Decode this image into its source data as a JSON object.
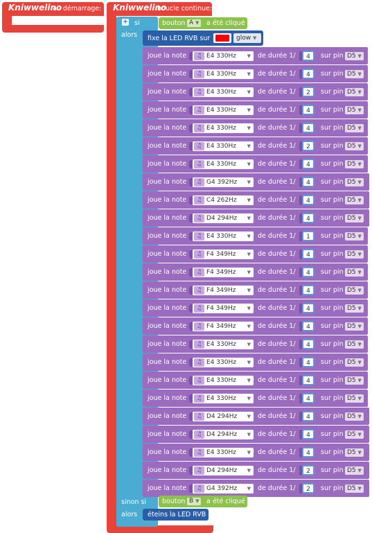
{
  "startup_block": {
    "logo": "Kniwwelino",
    "label": "au démarrage:"
  },
  "loop_block": {
    "logo": "Kniwwelino",
    "label": "boucle continue:"
  },
  "if_block": {
    "if_label": "si",
    "then_label": "alors",
    "elseif_label": "sinon si",
    "else_then_label": "alors",
    "condition1": {
      "prefix": "bouton",
      "button": "A",
      "suffix": "a été cliqué"
    },
    "condition2": {
      "prefix": "bouton",
      "button": "B",
      "suffix": "a été cliqué"
    },
    "led_block": {
      "label": "fixe la LED RVB sur",
      "color": "#ff0000",
      "mode": "glow"
    },
    "led_off_label": "éteins la LED RVB"
  },
  "note_labels": {
    "play": "joue la note",
    "duration": "de durée 1/",
    "pin": "sur pin"
  },
  "notes": [
    {
      "note": "E4 330Hz",
      "duration": "4",
      "pin": "D5"
    },
    {
      "note": "E4 330Hz",
      "duration": "4",
      "pin": "D5"
    },
    {
      "note": "E4 330Hz",
      "duration": "2",
      "pin": "D5"
    },
    {
      "note": "E4 330Hz",
      "duration": "4",
      "pin": "D5"
    },
    {
      "note": "E4 330Hz",
      "duration": "4",
      "pin": "D5"
    },
    {
      "note": "E4 330Hz",
      "duration": "2",
      "pin": "D5"
    },
    {
      "note": "E4 330Hz",
      "duration": "4",
      "pin": "D5"
    },
    {
      "note": "G4 392Hz",
      "duration": "4",
      "pin": "D5"
    },
    {
      "note": "C4 262Hz",
      "duration": "4",
      "pin": "D5"
    },
    {
      "note": "D4 294Hz",
      "duration": "4",
      "pin": "D5"
    },
    {
      "note": "E4 330Hz",
      "duration": "1",
      "pin": "D5"
    },
    {
      "note": "F4 349Hz",
      "duration": "4",
      "pin": "D5"
    },
    {
      "note": "F4 349Hz",
      "duration": "4",
      "pin": "D5"
    },
    {
      "note": "F4 349Hz",
      "duration": "4",
      "pin": "D5"
    },
    {
      "note": "F4 349Hz",
      "duration": "4",
      "pin": "D5"
    },
    {
      "note": "F4 349Hz",
      "duration": "4",
      "pin": "D5"
    },
    {
      "note": "E4 330Hz",
      "duration": "4",
      "pin": "D5"
    },
    {
      "note": "E4 330Hz",
      "duration": "4",
      "pin": "D5"
    },
    {
      "note": "E4 330Hz",
      "duration": "4",
      "pin": "D5"
    },
    {
      "note": "E4 330Hz",
      "duration": "4",
      "pin": "D5"
    },
    {
      "note": "D4 294Hz",
      "duration": "4",
      "pin": "D5"
    },
    {
      "note": "D4 294Hz",
      "duration": "4",
      "pin": "D5"
    },
    {
      "note": "E4 330Hz",
      "duration": "4",
      "pin": "D5"
    },
    {
      "note": "D4 294Hz",
      "duration": "2",
      "pin": "D5"
    },
    {
      "note": "G4 392Hz",
      "duration": "2",
      "pin": "D5"
    }
  ]
}
